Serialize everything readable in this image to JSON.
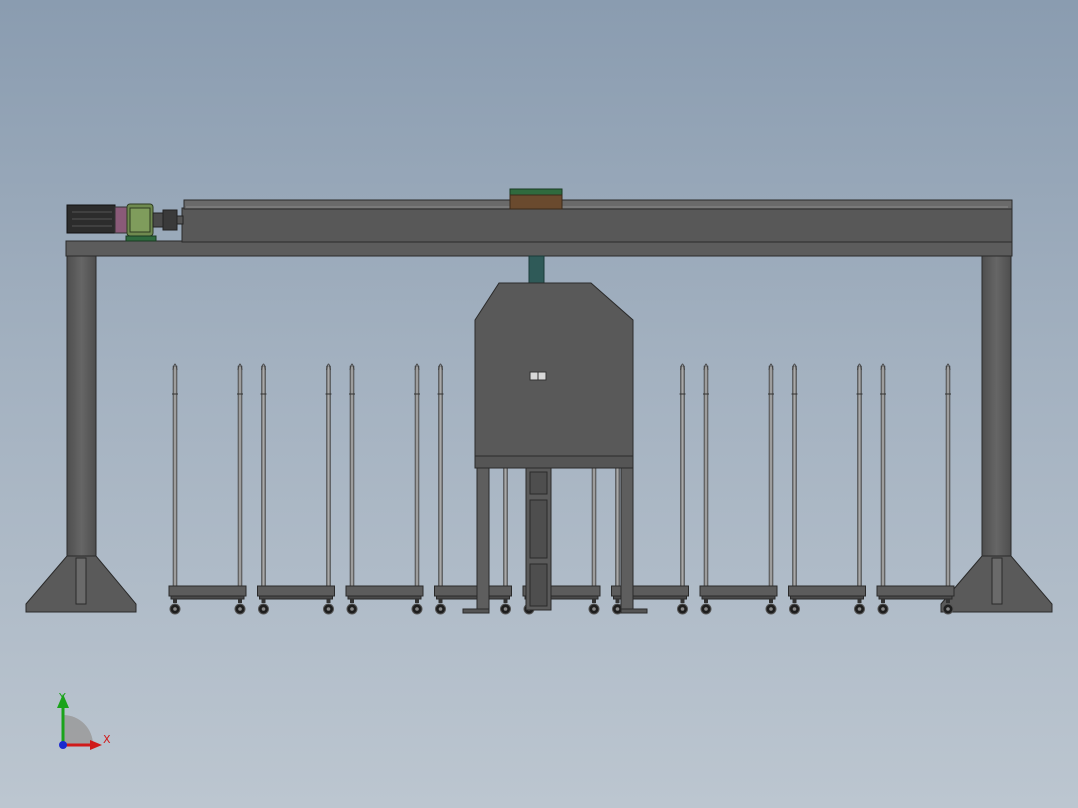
{
  "viewport": {
    "background_top": "#8a9cb0",
    "background_bottom": "#bcc6d0"
  },
  "colors": {
    "steel": "#5b5b5b",
    "steel_light": "#6a6a6a",
    "outline": "#2a2a2a",
    "rod": "#8c8c8c",
    "motor_dark": "#2c2c2c",
    "gearbox_green": "#6f8a4f",
    "coupling_pink": "#8a5a78",
    "carriage_green": "#2f6a3e",
    "carriage_brown": "#6a4a2e",
    "column_teal": "#2f5a58",
    "axis_y": "#1aa31a",
    "axis_x": "#d01a1a",
    "axis_z": "#1a2ad0"
  },
  "triad": {
    "x_label": "X",
    "y_label": "Y"
  },
  "rack_carts_count": 9
}
